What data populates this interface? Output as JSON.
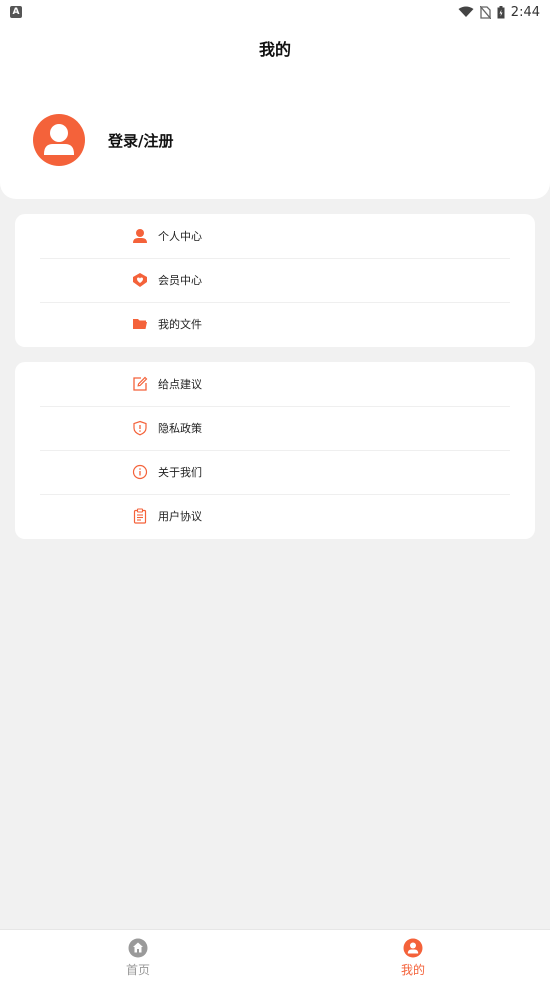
{
  "status_bar": {
    "time": "2:44",
    "app_badge": "A"
  },
  "header": {
    "title": "我的",
    "login_label": "登录/注册"
  },
  "menu_group_1": [
    {
      "label": "个人中心",
      "icon": "person-icon"
    },
    {
      "label": "会员中心",
      "icon": "heart-badge-icon"
    },
    {
      "label": "我的文件",
      "icon": "folder-icon"
    }
  ],
  "menu_group_2": [
    {
      "label": "给点建议",
      "icon": "edit-icon"
    },
    {
      "label": "隐私政策",
      "icon": "shield-icon"
    },
    {
      "label": "关于我们",
      "icon": "info-icon"
    },
    {
      "label": "用户协议",
      "icon": "clipboard-icon"
    }
  ],
  "bottom_nav": [
    {
      "label": "首页",
      "icon": "home-icon",
      "active": false
    },
    {
      "label": "我的",
      "icon": "user-icon",
      "active": true
    }
  ],
  "colors": {
    "accent": "#f4623a",
    "background": "#f1f1f1",
    "inactive": "#999999"
  }
}
